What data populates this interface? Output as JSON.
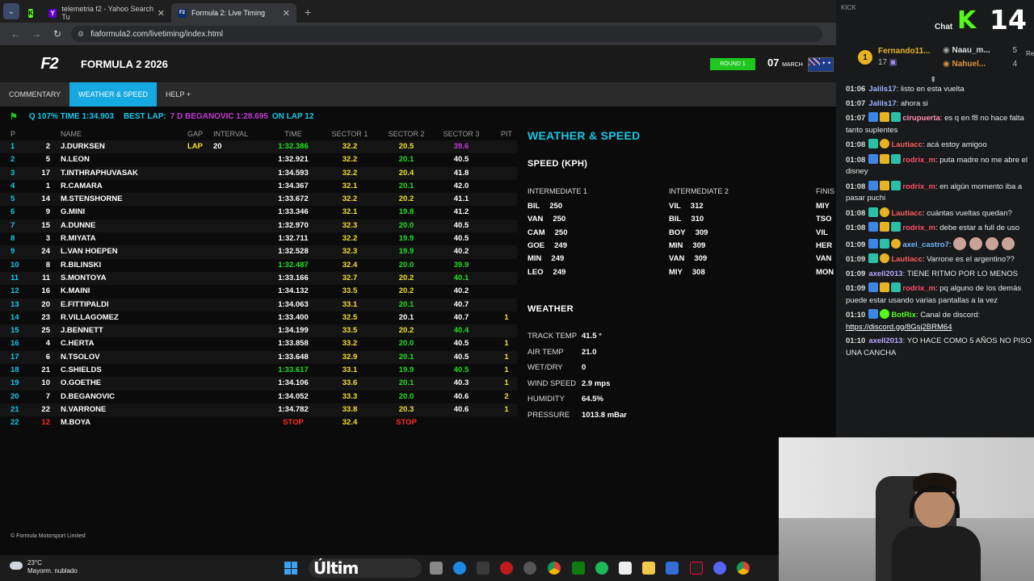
{
  "browser": {
    "tabs": [
      {
        "label": "",
        "icon": "kick-icon"
      },
      {
        "label": "telemetria f2 - Yahoo Search Tu",
        "icon": "yahoo-icon"
      },
      {
        "label": "Formula 2: Live Timing",
        "icon": "f2-icon"
      }
    ],
    "new_tab": "+",
    "close": "✕",
    "url": "fiaformula2.com/livetiming/index.html"
  },
  "site": {
    "logo": "F2",
    "title": "FORMULA 2 2026",
    "round": "ROUND 1",
    "date_day": "07",
    "date_month": "MARCH"
  },
  "nav": {
    "items": [
      "COMMENTARY",
      "WEATHER & SPEED",
      "HELP  +"
    ]
  },
  "info": {
    "q107": "Q 107% TIME 1:34.903",
    "best_lap_label": "BEST LAP:",
    "best_lap_value": "7 D BEGANOVIC 1:28.695",
    "on_lap": "ON LAP 12"
  },
  "timing": {
    "headers": [
      "P",
      "NAME",
      "GAP",
      "INTERVAL",
      "TIME",
      "SECTOR 1",
      "SECTOR 2",
      "SECTOR 3",
      "PIT"
    ],
    "rows": [
      {
        "p": "1",
        "n": "2",
        "name": "J.DURKSEN",
        "gap": "LAP",
        "int": "20",
        "time": "1:32.386",
        "tc": "green",
        "s1": "32.2",
        "s1c": "yellow",
        "s2": "20.5",
        "s2c": "yellow",
        "s3": "39.6",
        "s3c": "purple",
        "pit": ""
      },
      {
        "p": "2",
        "n": "5",
        "name": "N.LEON",
        "gap": "",
        "int": "",
        "time": "1:32.921",
        "tc": "white",
        "s1": "32.2",
        "s1c": "yellow",
        "s2": "20.1",
        "s2c": "green",
        "s3": "40.5",
        "s3c": "white",
        "pit": ""
      },
      {
        "p": "3",
        "n": "17",
        "name": "T.INTHRAPHUVASAK",
        "gap": "",
        "int": "",
        "time": "1:34.593",
        "tc": "white",
        "s1": "32.2",
        "s1c": "yellow",
        "s2": "20.4",
        "s2c": "yellow",
        "s3": "41.8",
        "s3c": "white",
        "pit": ""
      },
      {
        "p": "4",
        "n": "1",
        "name": "R.CAMARA",
        "gap": "",
        "int": "",
        "time": "1:34.367",
        "tc": "white",
        "s1": "32.1",
        "s1c": "yellow",
        "s2": "20.1",
        "s2c": "green",
        "s3": "42.0",
        "s3c": "white",
        "pit": ""
      },
      {
        "p": "5",
        "n": "14",
        "name": "M.STENSHORNE",
        "gap": "",
        "int": "",
        "time": "1:33.672",
        "tc": "white",
        "s1": "32.2",
        "s1c": "yellow",
        "s2": "20.2",
        "s2c": "yellow",
        "s3": "41.1",
        "s3c": "white",
        "pit": ""
      },
      {
        "p": "6",
        "n": "9",
        "name": "G.MINI",
        "gap": "",
        "int": "",
        "time": "1:33.346",
        "tc": "white",
        "s1": "32.1",
        "s1c": "yellow",
        "s2": "19.8",
        "s2c": "green",
        "s3": "41.2",
        "s3c": "white",
        "pit": ""
      },
      {
        "p": "7",
        "n": "15",
        "name": "A.DUNNE",
        "gap": "",
        "int": "",
        "time": "1:32.970",
        "tc": "white",
        "s1": "32.3",
        "s1c": "yellow",
        "s2": "20.0",
        "s2c": "green",
        "s3": "40.5",
        "s3c": "white",
        "pit": ""
      },
      {
        "p": "8",
        "n": "3",
        "name": "R.MIYATA",
        "gap": "",
        "int": "",
        "time": "1:32.711",
        "tc": "white",
        "s1": "32.2",
        "s1c": "yellow",
        "s2": "19.9",
        "s2c": "green",
        "s3": "40.5",
        "s3c": "white",
        "pit": ""
      },
      {
        "p": "9",
        "n": "24",
        "name": "L.VAN HOEPEN",
        "gap": "",
        "int": "",
        "time": "1:32.528",
        "tc": "white",
        "s1": "32.3",
        "s1c": "yellow",
        "s2": "19.9",
        "s2c": "green",
        "s3": "40.2",
        "s3c": "white",
        "pit": ""
      },
      {
        "p": "10",
        "n": "8",
        "name": "R.BILINSKI",
        "gap": "",
        "int": "",
        "time": "1:32.487",
        "tc": "green",
        "s1": "32.4",
        "s1c": "yellow",
        "s2": "20.0",
        "s2c": "green",
        "s3": "39.9",
        "s3c": "green",
        "pit": ""
      },
      {
        "p": "11",
        "n": "11",
        "name": "S.MONTOYA",
        "gap": "",
        "int": "",
        "time": "1:33.166",
        "tc": "white",
        "s1": "32.7",
        "s1c": "yellow",
        "s2": "20.2",
        "s2c": "yellow",
        "s3": "40.1",
        "s3c": "green",
        "pit": ""
      },
      {
        "p": "12",
        "n": "16",
        "name": "K.MAINI",
        "gap": "",
        "int": "",
        "time": "1:34.132",
        "tc": "white",
        "s1": "33.5",
        "s1c": "yellow",
        "s2": "20.2",
        "s2c": "yellow",
        "s3": "40.2",
        "s3c": "white",
        "pit": ""
      },
      {
        "p": "13",
        "n": "20",
        "name": "E.FITTIPALDI",
        "gap": "",
        "int": "",
        "time": "1:34.063",
        "tc": "white",
        "s1": "33.1",
        "s1c": "yellow",
        "s2": "20.1",
        "s2c": "green",
        "s3": "40.7",
        "s3c": "white",
        "pit": ""
      },
      {
        "p": "14",
        "n": "23",
        "name": "R.VILLAGOMEZ",
        "gap": "",
        "int": "",
        "time": "1:33.400",
        "tc": "white",
        "s1": "32.5",
        "s1c": "yellow",
        "s2": "20.1",
        "s2c": "white",
        "s3": "40.7",
        "s3c": "white",
        "pit": "1"
      },
      {
        "p": "15",
        "n": "25",
        "name": "J.BENNETT",
        "gap": "",
        "int": "",
        "time": "1:34.199",
        "tc": "white",
        "s1": "33.5",
        "s1c": "yellow",
        "s2": "20.2",
        "s2c": "yellow",
        "s3": "40.4",
        "s3c": "green",
        "pit": ""
      },
      {
        "p": "16",
        "n": "4",
        "name": "C.HERTA",
        "gap": "",
        "int": "",
        "time": "1:33.858",
        "tc": "white",
        "s1": "33.2",
        "s1c": "yellow",
        "s2": "20.0",
        "s2c": "green",
        "s3": "40.5",
        "s3c": "white",
        "pit": "1"
      },
      {
        "p": "17",
        "n": "6",
        "name": "N.TSOLOV",
        "gap": "",
        "int": "",
        "time": "1:33.648",
        "tc": "white",
        "s1": "32.9",
        "s1c": "yellow",
        "s2": "20.1",
        "s2c": "green",
        "s3": "40.5",
        "s3c": "white",
        "pit": "1"
      },
      {
        "p": "18",
        "n": "21",
        "name": "C.SHIELDS",
        "gap": "",
        "int": "",
        "time": "1:33.617",
        "tc": "green",
        "s1": "33.1",
        "s1c": "yellow",
        "s2": "19.9",
        "s2c": "green",
        "s3": "40.5",
        "s3c": "green",
        "pit": "1"
      },
      {
        "p": "19",
        "n": "10",
        "name": "O.GOETHE",
        "gap": "",
        "int": "",
        "time": "1:34.106",
        "tc": "white",
        "s1": "33.6",
        "s1c": "yellow",
        "s2": "20.1",
        "s2c": "green",
        "s3": "40.3",
        "s3c": "white",
        "pit": "1"
      },
      {
        "p": "20",
        "n": "7",
        "name": "D.BEGANOVIC",
        "gap": "",
        "int": "",
        "time": "1:34.052",
        "tc": "white",
        "s1": "33.3",
        "s1c": "yellow",
        "s2": "20.0",
        "s2c": "green",
        "s3": "40.6",
        "s3c": "white",
        "pit": "2"
      },
      {
        "p": "21",
        "n": "22",
        "name": "N.VARRONE",
        "gap": "",
        "int": "",
        "time": "1:34.782",
        "tc": "white",
        "s1": "33.8",
        "s1c": "yellow",
        "s2": "20.3",
        "s2c": "yellow",
        "s3": "40.6",
        "s3c": "white",
        "pit": "1"
      },
      {
        "p": "22",
        "n": "12",
        "name": "M.BOYA",
        "gap": "",
        "int": "",
        "time": "STOP",
        "tc": "red",
        "s1": "32.4",
        "s1c": "yellow",
        "s2": "STOP",
        "s2c": "red",
        "s3": "",
        "s3c": "white",
        "pit": ""
      }
    ]
  },
  "weather_speed": {
    "title": "WEATHER & SPEED",
    "speed_title": "SPEED (KPH)",
    "speed_headers": [
      "INTERMEDIATE 1",
      "INTERMEDIATE 2",
      "FINIS"
    ],
    "int1": [
      [
        "BIL",
        "250"
      ],
      [
        "VAN",
        "250"
      ],
      [
        "CAM",
        "250"
      ],
      [
        "GOE",
        "249"
      ],
      [
        "MIN",
        "249"
      ],
      [
        "LEO",
        "249"
      ]
    ],
    "int2": [
      [
        "VIL",
        "312"
      ],
      [
        "BIL",
        "310"
      ],
      [
        "BOY",
        "309"
      ],
      [
        "MIN",
        "309"
      ],
      [
        "VAN",
        "309"
      ],
      [
        "MIY",
        "308"
      ]
    ],
    "finish": [
      "MIY",
      "TSO",
      "VIL",
      "HER",
      "VAN",
      "MON"
    ],
    "weather_title": "WEATHER",
    "weather": [
      {
        "label": "TRACK TEMP",
        "value": "41.5 °"
      },
      {
        "label": "AIR TEMP",
        "value": "21.0"
      },
      {
        "label": "WET/DRY",
        "value": "0"
      },
      {
        "label": "WIND SPEED",
        "value": "2.9 mps"
      },
      {
        "label": "HUMIDITY",
        "value": "64.5%"
      },
      {
        "label": "PRESSURE",
        "value": "1013.8 mBar"
      }
    ]
  },
  "copyright": "© Formula Motorsport Limited",
  "chat": {
    "kick": "KICK",
    "title": "Chat",
    "k": "K",
    "count": "14",
    "leaders": [
      {
        "name": "Fernando11...",
        "count": "17",
        "medal": "1"
      },
      {
        "name": "Naau_m...",
        "count": "5"
      },
      {
        "name": "Nahuel...",
        "count": "4"
      }
    ],
    "side_label": "Re",
    "messages": [
      {
        "t": "01:06",
        "u": "Jalils17",
        "uc": "#9db4ff",
        "badges": [],
        "m": "listo en esta vuelta"
      },
      {
        "t": "01:07",
        "u": "Jalils17",
        "uc": "#9db4ff",
        "badges": [],
        "m": "ahora si"
      },
      {
        "t": "01:07",
        "u": "cirupuerta",
        "uc": "#ff8fb1",
        "badges": [
          "b-blue",
          "b-gold",
          "b-teal"
        ],
        "m": "es q en f8 no hace falta tanto suplentes"
      },
      {
        "t": "01:08",
        "u": "Lautiacc",
        "uc": "#ff5f5f",
        "badges": [
          "b-teal",
          "b-coin"
        ],
        "m": "acá estoy amigoo"
      },
      {
        "t": "01:08",
        "u": "rodrix_m",
        "uc": "#ff4d6d",
        "badges": [
          "b-blue",
          "b-gold",
          "b-teal"
        ],
        "m": "puta madre no me abre el disney"
      },
      {
        "t": "01:08",
        "u": "rodrix_m",
        "uc": "#ff4d6d",
        "badges": [
          "b-blue",
          "b-gold",
          "b-teal"
        ],
        "m": "en algún momento iba a pasar puchi"
      },
      {
        "t": "01:08",
        "u": "Lautiacc",
        "uc": "#ff5f5f",
        "badges": [
          "b-teal",
          "b-coin"
        ],
        "m": "cuántas vueltas quedan?"
      },
      {
        "t": "01:08",
        "u": "rodrix_m",
        "uc": "#ff4d6d",
        "badges": [
          "b-blue",
          "b-gold",
          "b-teal"
        ],
        "m": "debe estar a full de uso"
      },
      {
        "t": "01:09",
        "u": "axel_castro7",
        "uc": "#6fb7ff",
        "badges": [
          "b-blue",
          "b-teal",
          "b-coin"
        ],
        "m": "",
        "emotes": 4
      },
      {
        "t": "01:09",
        "u": "Lautiacc",
        "uc": "#ff5f5f",
        "badges": [
          "b-teal",
          "b-coin"
        ],
        "m": "Varrone es el argentino??"
      },
      {
        "t": "01:09",
        "u": "axell2013",
        "uc": "#b9a8ff",
        "badges": [],
        "m": "TIENE RITMO POR LO MENOS"
      },
      {
        "t": "01:09",
        "u": "rodrix_m",
        "uc": "#ff4d6d",
        "badges": [
          "b-blue",
          "b-gold",
          "b-teal"
        ],
        "m": "pq alguno de los demás puede estar usando varias pantallas a la vez"
      },
      {
        "t": "01:10",
        "u": "BotRix",
        "uc": "#53fc18",
        "badges": [
          "b-blue",
          "b-green"
        ],
        "m": "Canal de discord:",
        "link": "https://discord.gg/8Gsj2BRM64"
      },
      {
        "t": "01:10",
        "u": "axell2013",
        "uc": "#b9a8ff",
        "badges": [],
        "m": "YO HACE COMO 5 AÑOS NO PISO UNA CANCHA"
      }
    ]
  },
  "taskbar": {
    "temp": "23°C",
    "weather": "Mayorm. nublado",
    "search_text": "Últim"
  },
  "colors": {
    "accent": "#16a9e1",
    "green": "#22e022",
    "yellow": "#f0e030",
    "purple": "#c43ad6",
    "kick": "#53fc18"
  }
}
